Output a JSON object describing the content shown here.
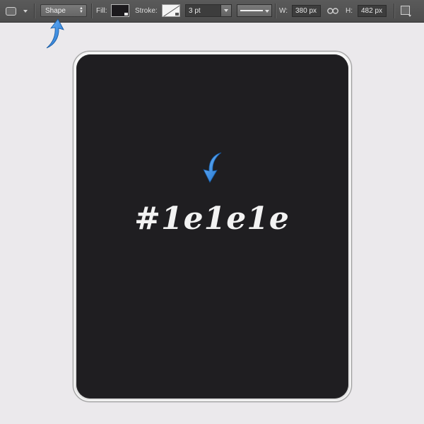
{
  "toolbar": {
    "mode": "Shape",
    "fill_label": "Fill:",
    "stroke_label": "Stroke:",
    "stroke_width": "3 pt",
    "width_label": "W:",
    "width_value": "380 px",
    "height_label": "H:",
    "height_value": "482 px"
  },
  "canvas": {
    "shape_fill_color": "#1e1e1e",
    "color_label": "#1e1e1e"
  },
  "colors": {
    "toolbar_bg": "#535353",
    "canvas_bg": "#ebe9ec",
    "shape_fill": "#1f1e21",
    "annotation_arrow": "#2e8ae6"
  },
  "icons": [
    "rounded-rectangle-tool-icon",
    "link-dimensions-icon",
    "path-alignment-icon",
    "annotation-arrow-icon"
  ]
}
